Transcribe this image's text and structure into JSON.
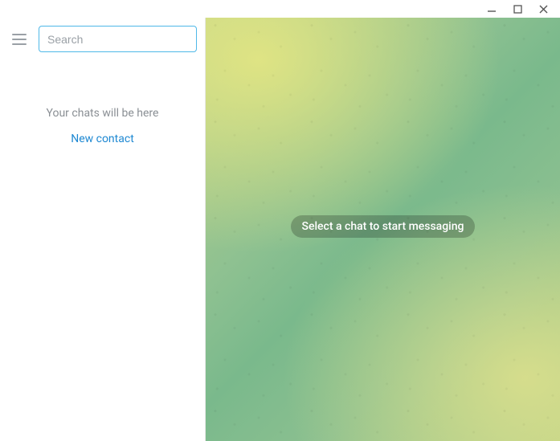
{
  "titlebar": {
    "minimize_glyph": "−",
    "maximize_glyph": "▢",
    "close_glyph": "✕"
  },
  "sidebar": {
    "search_placeholder": "Search",
    "search_value": "",
    "empty_text": "Your chats will be here",
    "new_contact_label": "New contact"
  },
  "chat_area": {
    "placeholder_text": "Select a chat to start messaging"
  },
  "colors": {
    "accent": "#4fb8e8",
    "link": "#1e88d2",
    "muted_text": "#8a8f94"
  }
}
